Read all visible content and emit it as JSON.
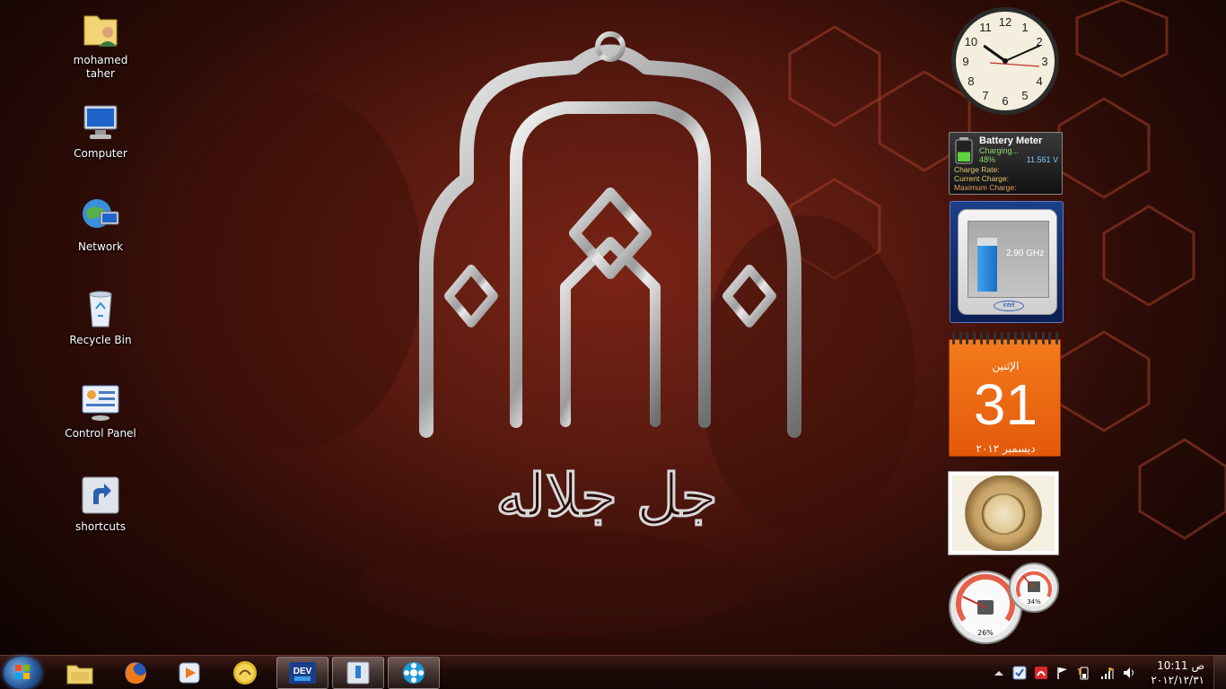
{
  "desktop": {
    "icons": [
      {
        "label": "mohamed taher",
        "icon": "user-folder-icon"
      },
      {
        "label": "Computer",
        "icon": "computer-icon"
      },
      {
        "label": "Network",
        "icon": "network-icon"
      },
      {
        "label": "Recycle Bin",
        "icon": "recycle-bin-icon"
      },
      {
        "label": "Control Panel",
        "icon": "control-panel-icon"
      },
      {
        "label": "shortcuts",
        "icon": "shortcut-icon"
      }
    ],
    "wallpaper_text": "جل جلاله"
  },
  "gadgets": {
    "clock": {
      "numbers": [
        "12",
        "1",
        "2",
        "3",
        "4",
        "5",
        "6",
        "7",
        "8",
        "9",
        "10",
        "11"
      ],
      "hour": 10,
      "minute": 11
    },
    "battery": {
      "title": "Battery Meter",
      "status": "Charging...",
      "percent": "48%",
      "voltage": "11.561 V",
      "charge_rate_label": "Charge Rate:",
      "current_charge_label": "Current Charge:",
      "maximum_charge_label": "Maximum Charge:",
      "level": 0.48
    },
    "cpu": {
      "frequency": "2.90 GHz",
      "brand": "intel",
      "level": 0.85
    },
    "calendar": {
      "day_name": "الإثنين",
      "day": "31",
      "month_year": "ديسمبر ٢٠١٢"
    },
    "meter": {
      "cpu_usage": "26%",
      "memory_usage": "34%",
      "cpu_level": 0.26,
      "memory_level": 0.34
    }
  },
  "taskbar": {
    "pinned": [
      "start-orb",
      "windows-explorer",
      "firefox",
      "media-player",
      "app-logo",
      "devexpress",
      "app-window",
      "media-center"
    ],
    "clock_time": "10:11 ص",
    "clock_date": "٢٠١٢/١٢/٣١"
  },
  "colors": {
    "accent": "#e45a0b",
    "taskbar": "#1c0a07",
    "wallpaper": "#5a1a10"
  }
}
